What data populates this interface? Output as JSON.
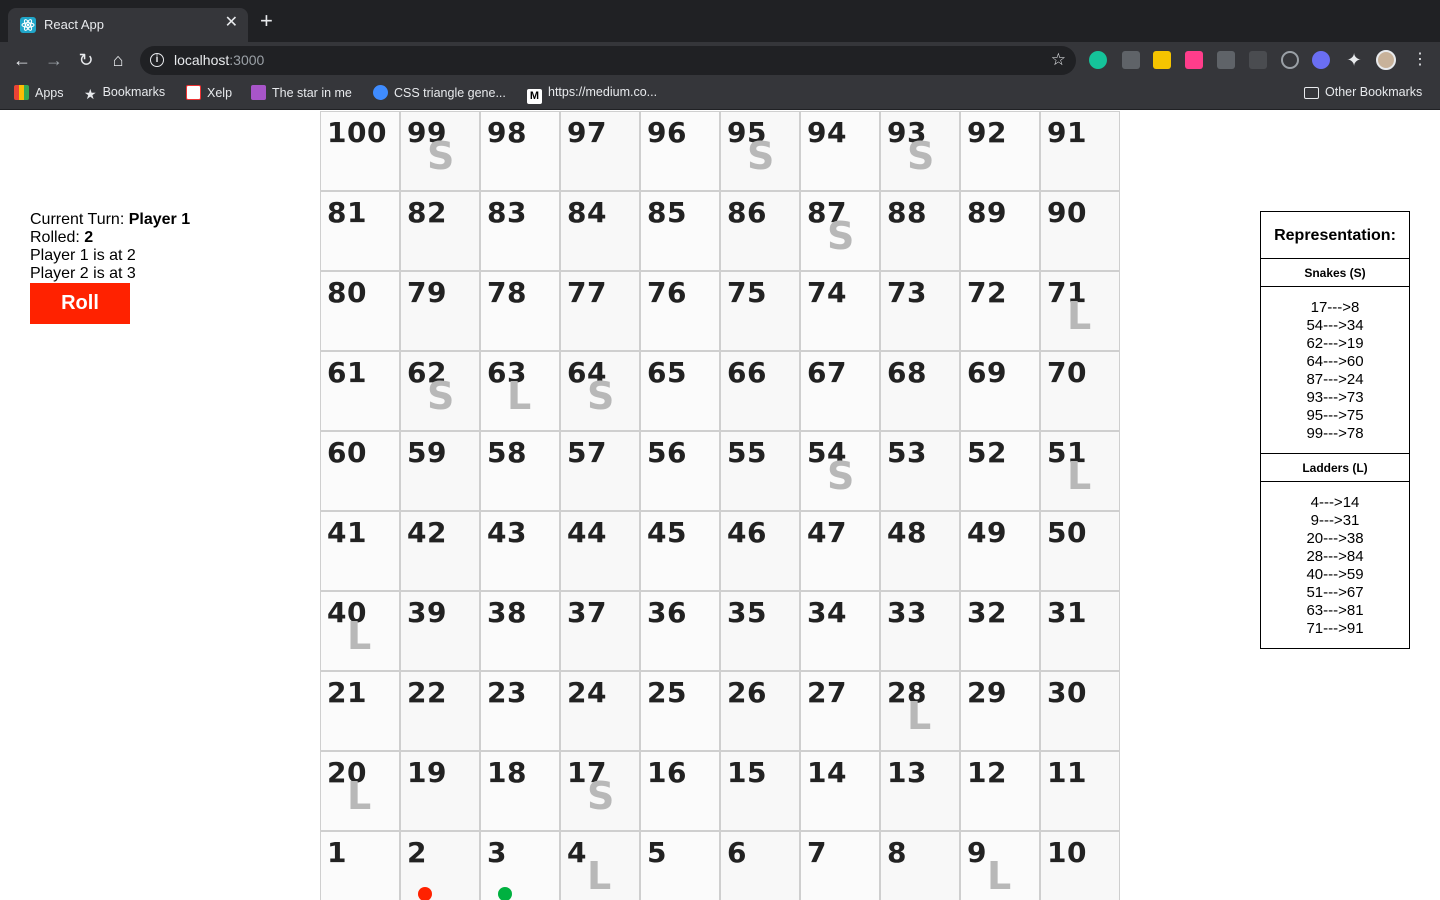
{
  "browser": {
    "tab_title": "React App",
    "url_host": "localhost",
    "url_port": ":3000",
    "bookmarks": [
      "Apps",
      "Bookmarks",
      "Xelp",
      "The star in me",
      "CSS triangle gene...",
      "https://medium.co..."
    ],
    "other_bookmarks": "Other Bookmarks"
  },
  "game": {
    "turn_label": "Current Turn:",
    "turn_player": "Player 1",
    "rolled_label": "Rolled:",
    "rolled_value": "2",
    "player1_status": "Player 1 is at 2",
    "player2_status": "Player 2 is at 3",
    "roll_label": "Roll"
  },
  "board": {
    "rows": [
      [
        100,
        99,
        98,
        97,
        96,
        95,
        94,
        93,
        92,
        91
      ],
      [
        81,
        82,
        83,
        84,
        85,
        86,
        87,
        88,
        89,
        90
      ],
      [
        80,
        79,
        78,
        77,
        76,
        75,
        74,
        73,
        72,
        71
      ],
      [
        61,
        62,
        63,
        64,
        65,
        66,
        67,
        68,
        69,
        70
      ],
      [
        60,
        59,
        58,
        57,
        56,
        55,
        54,
        53,
        52,
        51
      ],
      [
        41,
        42,
        43,
        44,
        45,
        46,
        47,
        48,
        49,
        50
      ],
      [
        40,
        39,
        38,
        37,
        36,
        35,
        34,
        33,
        32,
        31
      ],
      [
        21,
        22,
        23,
        24,
        25,
        26,
        27,
        28,
        29,
        30
      ],
      [
        20,
        19,
        18,
        17,
        16,
        15,
        14,
        13,
        12,
        11
      ],
      [
        1,
        2,
        3,
        4,
        5,
        6,
        7,
        8,
        9,
        10
      ]
    ],
    "snake_cells": [
      17,
      54,
      62,
      64,
      87,
      93,
      95,
      99
    ],
    "ladder_cells": [
      4,
      9,
      20,
      28,
      40,
      51,
      63,
      71
    ],
    "snake_mark": "S",
    "ladder_mark": "L",
    "players": [
      {
        "name": "Player 1",
        "cell": 2,
        "color": "#ff2200"
      },
      {
        "name": "Player 2",
        "cell": 3,
        "color": "#00b140"
      }
    ]
  },
  "legend": {
    "title": "Representation:",
    "snakes_title": "Snakes (S)",
    "snakes": [
      "17--->8",
      "54--->34",
      "62--->19",
      "64--->60",
      "87--->24",
      "93--->73",
      "95--->75",
      "99--->78"
    ],
    "ladders_title": "Ladders (L)",
    "ladders": [
      "4--->14",
      "9--->31",
      "20--->38",
      "28--->84",
      "40--->59",
      "51--->67",
      "63--->81",
      "71--->91"
    ]
  }
}
